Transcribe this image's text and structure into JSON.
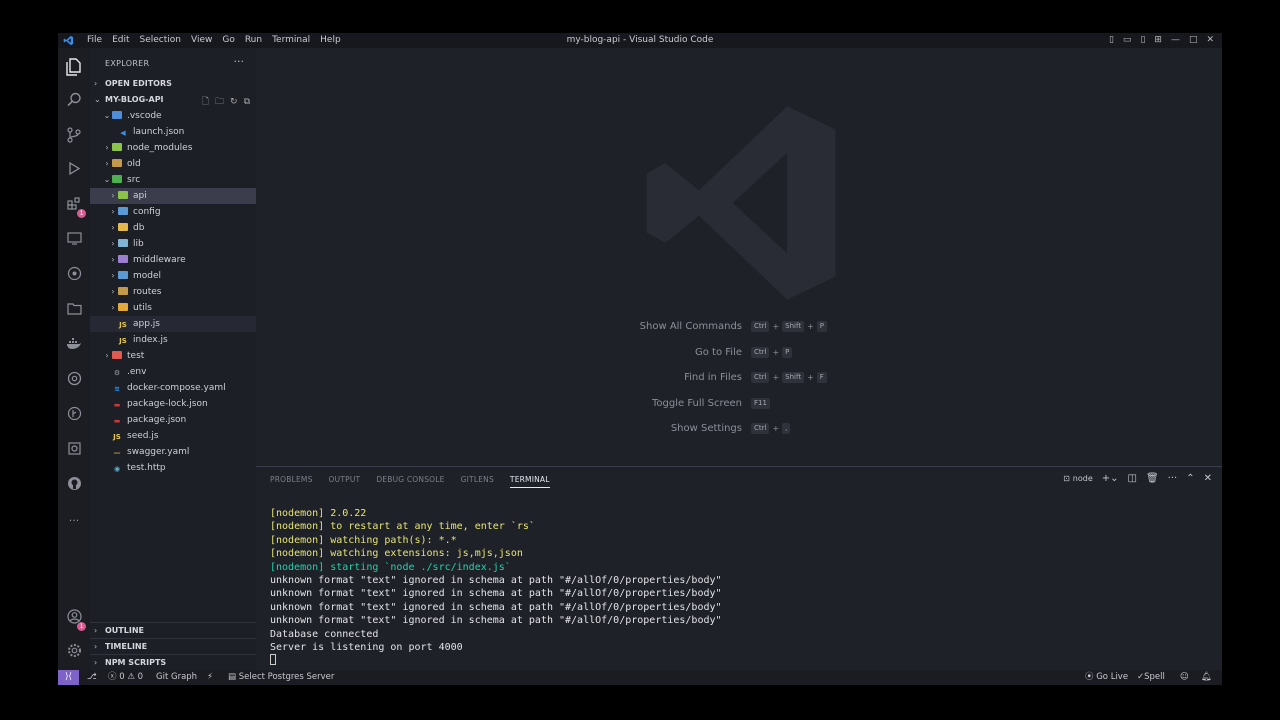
{
  "window": {
    "title": "my-blog-api - Visual Studio Code",
    "menu": [
      "File",
      "Edit",
      "Selection",
      "View",
      "Go",
      "Run",
      "Terminal",
      "Help"
    ]
  },
  "activity_bar": {
    "icons": [
      "files-icon",
      "search-icon",
      "source-control-icon",
      "run-debug-icon",
      "extensions-icon",
      "remote-explorer-icon",
      "gitlens-icon",
      "project-manager-icon",
      "docker-icon",
      "kubernetes-icon",
      "git-graph-icon",
      "database-icon",
      "github-icon",
      "more-icon"
    ],
    "extensions_badge": "1",
    "accounts_badge": "1"
  },
  "sidebar": {
    "title": "EXPLORER",
    "open_editors": "OPEN EDITORS",
    "project": "MY-BLOG-API",
    "tree": [
      {
        "label": ".vscode",
        "indent": 1,
        "chevron": "open",
        "icon": "folder-vscode",
        "color": "#4f8ddb"
      },
      {
        "label": "launch.json",
        "indent": 2,
        "chevron": "none",
        "icon": "vscode-file",
        "color": "#3b8ee8"
      },
      {
        "label": "node_modules",
        "indent": 1,
        "chevron": "closed",
        "icon": "folder-node",
        "color": "#8bc34a"
      },
      {
        "label": "old",
        "indent": 1,
        "chevron": "closed",
        "icon": "folder",
        "color": "#c29a4a"
      },
      {
        "label": "src",
        "indent": 1,
        "chevron": "open",
        "icon": "folder-src",
        "color": "#4caf50"
      },
      {
        "label": "api",
        "indent": 2,
        "chevron": "closed",
        "icon": "folder-api",
        "color": "#8bc34a",
        "selected": true
      },
      {
        "label": "config",
        "indent": 2,
        "chevron": "closed",
        "icon": "folder-config",
        "color": "#5b9bd5"
      },
      {
        "label": "db",
        "indent": 2,
        "chevron": "closed",
        "icon": "folder-db",
        "color": "#e5b94a"
      },
      {
        "label": "lib",
        "indent": 2,
        "chevron": "closed",
        "icon": "folder-lib",
        "color": "#7fb3d5"
      },
      {
        "label": "middleware",
        "indent": 2,
        "chevron": "closed",
        "icon": "folder-middleware",
        "color": "#9c7fd1"
      },
      {
        "label": "model",
        "indent": 2,
        "chevron": "closed",
        "icon": "folder-model",
        "color": "#5b9bd5"
      },
      {
        "label": "routes",
        "indent": 2,
        "chevron": "closed",
        "icon": "folder-routes",
        "color": "#c29a4a"
      },
      {
        "label": "utils",
        "indent": 2,
        "chevron": "closed",
        "icon": "folder-utils",
        "color": "#e5a83a"
      },
      {
        "label": "app.js",
        "indent": 2,
        "chevron": "none",
        "icon": "js",
        "color": "#e6c84a",
        "hover": true
      },
      {
        "label": "index.js",
        "indent": 2,
        "chevron": "none",
        "icon": "js",
        "color": "#e6c84a"
      },
      {
        "label": "test",
        "indent": 1,
        "chevron": "closed",
        "icon": "folder-test",
        "color": "#e05a4f"
      },
      {
        "label": ".env",
        "indent": 1,
        "chevron": "none",
        "icon": "gear",
        "color": "#9aa0a6"
      },
      {
        "label": "docker-compose.yaml",
        "indent": 1,
        "chevron": "none",
        "icon": "docker",
        "color": "#2496ed"
      },
      {
        "label": "package-lock.json",
        "indent": 1,
        "chevron": "none",
        "icon": "npm",
        "color": "#cb3837"
      },
      {
        "label": "package.json",
        "indent": 1,
        "chevron": "none",
        "icon": "npm",
        "color": "#cb3837"
      },
      {
        "label": "seed.js",
        "indent": 1,
        "chevron": "none",
        "icon": "js",
        "color": "#e6c84a"
      },
      {
        "label": "swagger.yaml",
        "indent": 1,
        "chevron": "none",
        "icon": "yaml",
        "color": "#c29a4a"
      },
      {
        "label": "test.http",
        "indent": 1,
        "chevron": "none",
        "icon": "http",
        "color": "#5fb4c8"
      }
    ],
    "outline": "OUTLINE",
    "timeline": "TIMELINE",
    "npm_scripts": "NPM SCRIPTS"
  },
  "editor": {
    "shortcuts": [
      {
        "label": "Show All Commands",
        "keys": [
          "Ctrl",
          "Shift",
          "P"
        ]
      },
      {
        "label": "Go to File",
        "keys": [
          "Ctrl",
          "P"
        ]
      },
      {
        "label": "Find in Files",
        "keys": [
          "Ctrl",
          "Shift",
          "F"
        ]
      },
      {
        "label": "Toggle Full Screen",
        "keys": [
          "F11"
        ]
      },
      {
        "label": "Show Settings",
        "keys": [
          "Ctrl",
          ","
        ]
      }
    ]
  },
  "panel": {
    "tabs": [
      "PROBLEMS",
      "OUTPUT",
      "DEBUG CONSOLE",
      "GITLENS",
      "TERMINAL"
    ],
    "active_tab": "TERMINAL",
    "terminal_name": "node",
    "lines": [
      {
        "text": "[nodemon] 2.0.22",
        "style": "yellow"
      },
      {
        "text": "[nodemon] to restart at any time, enter `rs`",
        "style": "yellow"
      },
      {
        "text": "[nodemon] watching path(s): *.*",
        "style": "yellow"
      },
      {
        "text": "[nodemon] watching extensions: js,mjs,json",
        "style": "yellow"
      },
      {
        "text": "[nodemon] starting `node ./src/index.js`",
        "style": "green"
      },
      {
        "text": "unknown format \"text\" ignored in schema at path \"#/allOf/0/properties/body\"",
        "style": "white"
      },
      {
        "text": "unknown format \"text\" ignored in schema at path \"#/allOf/0/properties/body\"",
        "style": "white"
      },
      {
        "text": "unknown format \"text\" ignored in schema at path \"#/allOf/0/properties/body\"",
        "style": "white"
      },
      {
        "text": "unknown format \"text\" ignored in schema at path \"#/allOf/0/properties/body\"",
        "style": "white"
      },
      {
        "text": "Database connected",
        "style": "white"
      },
      {
        "text": "Server is listening on port 4000",
        "style": "white"
      }
    ]
  },
  "status_bar": {
    "errors": "0",
    "warnings": "0",
    "git_graph": "Git Graph",
    "postgres": "Select Postgres Server",
    "go_live": "Go Live",
    "spell": "Spell"
  },
  "colors": {
    "accent": "#7d62c8",
    "terminal_yellow": "#e5e572",
    "terminal_green": "#22d3a8"
  }
}
